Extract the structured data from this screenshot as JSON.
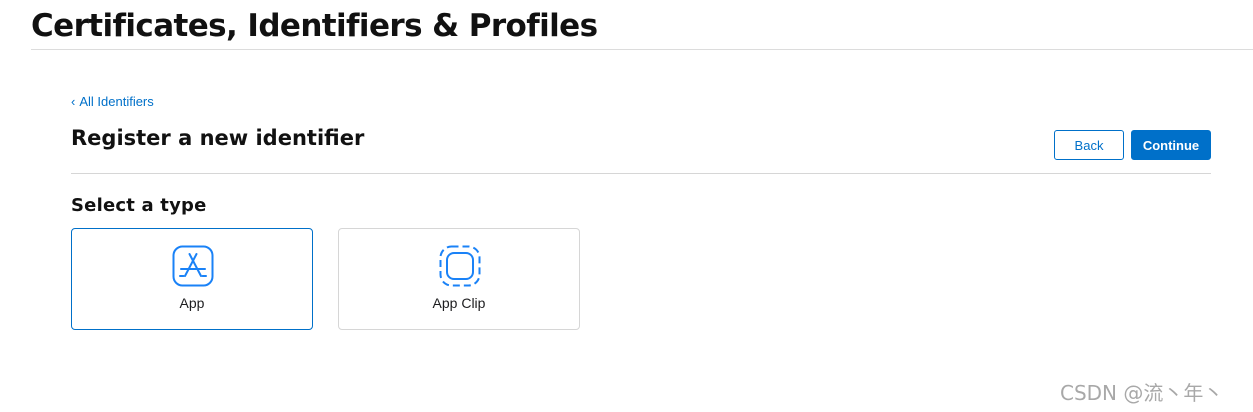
{
  "header": {
    "title": "Certificates, Identifiers & Profiles"
  },
  "nav": {
    "back_link_chevron": "‹",
    "back_link_label": "All Identifiers"
  },
  "page": {
    "heading": "Register a new identifier",
    "back_button_label": "Back",
    "continue_button_label": "Continue"
  },
  "type_section": {
    "heading": "Select a type",
    "options": [
      {
        "label": "App",
        "icon": "app-store-icon",
        "selected": true
      },
      {
        "label": "App Clip",
        "icon": "app-clip-icon",
        "selected": false
      }
    ]
  },
  "watermark": {
    "text": "CSDN @流丶年丶"
  },
  "colors": {
    "accent": "#0070c9",
    "text": "#111111",
    "divider": "#d6d6d6",
    "icon_blue": "#1a82f7"
  }
}
